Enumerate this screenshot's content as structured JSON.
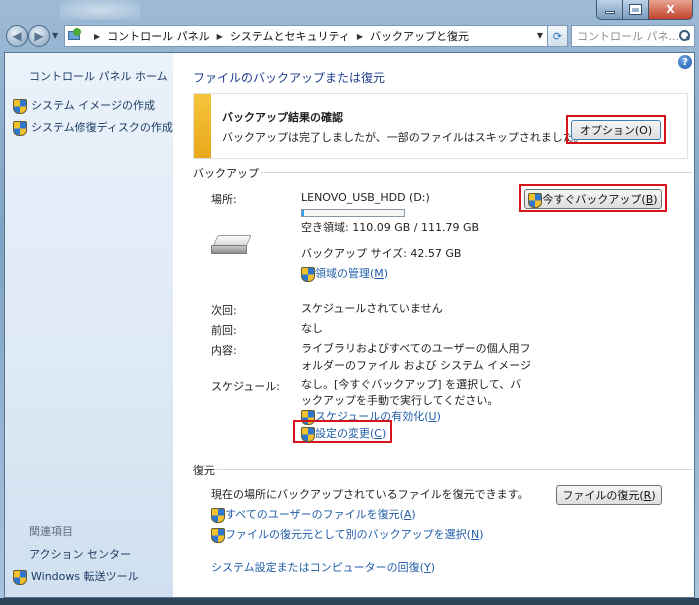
{
  "window": {
    "min_glyph": "minimize-icon",
    "max_glyph": "maximize-icon",
    "close_label": "X"
  },
  "address_bar": {
    "back": "◀",
    "forward": "▶",
    "crumbs": [
      "コントロール パネル",
      "システムとセキュリティ",
      "バックアップと復元"
    ],
    "search_placeholder": "コントロール パネ..."
  },
  "sidebar": {
    "home": "コントロール パネル ホーム",
    "items": [
      "システム イメージの作成",
      "システム修復ディスクの作成"
    ],
    "related_heading": "関連項目",
    "related": [
      "アクション センター",
      "Windows 転送ツール"
    ]
  },
  "main": {
    "title": "ファイルのバックアップまたは復元",
    "notice": {
      "title": "バックアップ結果の確認",
      "text": "バックアップは完了しましたが、一部のファイルはスキップされました。",
      "options_button": "オプション(O)"
    },
    "backup": {
      "section": "バックアップ",
      "location_label": "場所:",
      "location_value": "LENOVO_USB_HDD (D:)",
      "free_space": "空き領域: 110.09 GB / 111.79 GB",
      "used_fraction": 0.015,
      "backup_size": "バックアップ サイズ: 42.57 GB",
      "manage_space_text": "領域の管理(",
      "manage_space_key": "M",
      "backup_now_text": "今すぐバックアップ(",
      "backup_now_key": "B",
      "next_label": "次回:",
      "next_value": "スケジュールされていません",
      "last_label": "前回:",
      "last_value": "なし",
      "contents_label": "内容:",
      "contents_value_1": "ライブラリおよびすべてのユーザーの個人用フ",
      "contents_value_2": "ォルダーのファイル および システム イメージ",
      "schedule_label": "スケジュール:",
      "schedule_value_1": "なし。[今すぐバックアップ] を選択して、バ",
      "schedule_value_2": "ックアップを手動で実行してください。",
      "enable_schedule_text": "スケジュールの有効化(",
      "enable_schedule_key": "U",
      "change_settings_text": "設定の変更(",
      "change_settings_key": "C"
    },
    "restore": {
      "section": "復元",
      "description": "現在の場所にバックアップされているファイルを復元できます。",
      "restore_files_text": "ファイルの復元(",
      "restore_files_key": "R",
      "all_users_text": "すべてのユーザーのファイルを復元(",
      "all_users_key": "A",
      "other_backup_text": "ファイルの復元元として別のバックアップを選択(",
      "other_backup_key": "N",
      "recover_system_text": "システム設定またはコンピューターの回復(",
      "recover_system_key": "Y"
    }
  }
}
